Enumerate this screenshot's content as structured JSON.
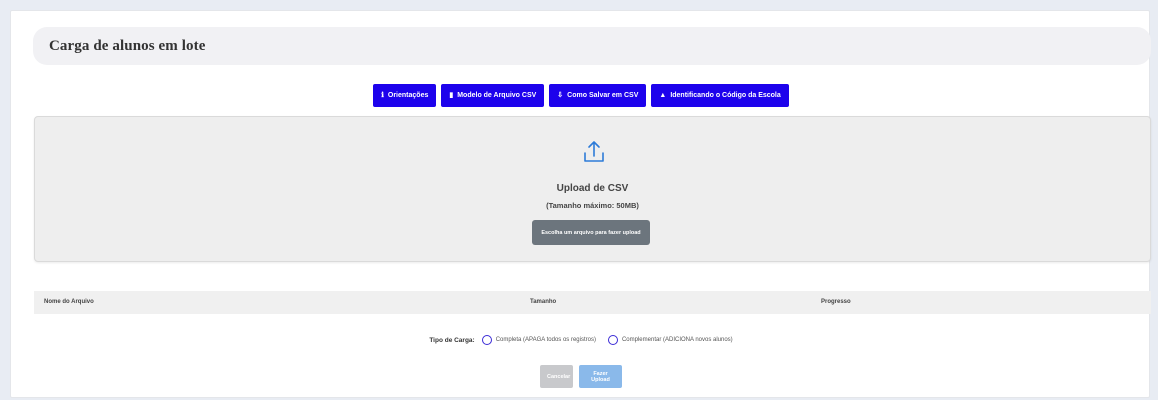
{
  "page": {
    "title": "Carga de alunos em lote"
  },
  "toolbar": {
    "buttons": [
      {
        "label": "Orientações",
        "icon": "info-icon"
      },
      {
        "label": "Modelo de Arquivo CSV",
        "icon": "file-icon"
      },
      {
        "label": "Como Salvar em CSV",
        "icon": "save-icon"
      },
      {
        "label": "Identificando o Código da Escola",
        "icon": "search-icon"
      }
    ]
  },
  "upload": {
    "icon": "upload-icon",
    "title": "Upload de CSV",
    "subtitle": "(Tamanho máximo: 50MB)",
    "choose_label": "Escolha um arquivo para fazer upload"
  },
  "table": {
    "columns": [
      "Nome do Arquivo",
      "Tamanho",
      "Progresso"
    ]
  },
  "load_type": {
    "label": "Tipo de Carga:",
    "options": [
      "Completa (APAGA todos os registros)",
      "Complementar (ADICIONA novos alunos)"
    ]
  },
  "actions": {
    "cancel_label": "Cancelar",
    "upload_label": "Fazer Upload"
  },
  "colors": {
    "primary": "#1d02ec",
    "secondary": "#6c757d",
    "upload_disabled": "#8ab9ea",
    "cancel_disabled": "#c8c9cc"
  }
}
